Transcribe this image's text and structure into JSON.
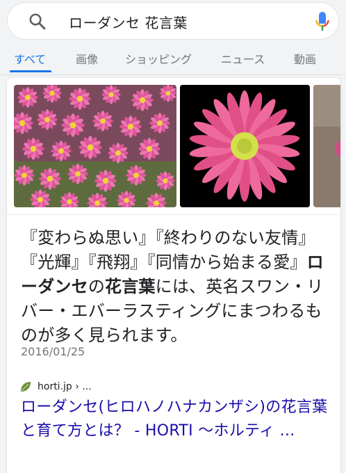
{
  "search": {
    "query": "ローダンセ 花言葉"
  },
  "tabs": [
    {
      "label": "すべて",
      "active": true
    },
    {
      "label": "画像",
      "active": false
    },
    {
      "label": "ショッピング",
      "active": false
    },
    {
      "label": "ニュース",
      "active": false
    },
    {
      "label": "動画",
      "active": false
    }
  ],
  "snippet": {
    "part1": "『変わらぬ思い』『終わりのない友情』『光輝』『飛翔』『同情から始まる愛』",
    "bold1": "ローダンセ",
    "part2": "の",
    "bold2": "花言葉",
    "part3": "には、英名スワン・リバー・エバーラスティングにまつわるものが多く見られます。",
    "date": "2016/01/25"
  },
  "result": {
    "source": "horti.jp › ...",
    "title": "ローダンセ(ヒロハノハナカンザシ)の花言葉と育て方とは？ - HORTI 〜ホルティ ..."
  },
  "colors": {
    "accent": "#1a73e8",
    "link": "#1a0dab",
    "text": "#202124",
    "muted": "#70757a"
  },
  "icons": {
    "search": "magnifier-icon",
    "mic": "google-mic-icon",
    "source": "leaf-icon"
  }
}
